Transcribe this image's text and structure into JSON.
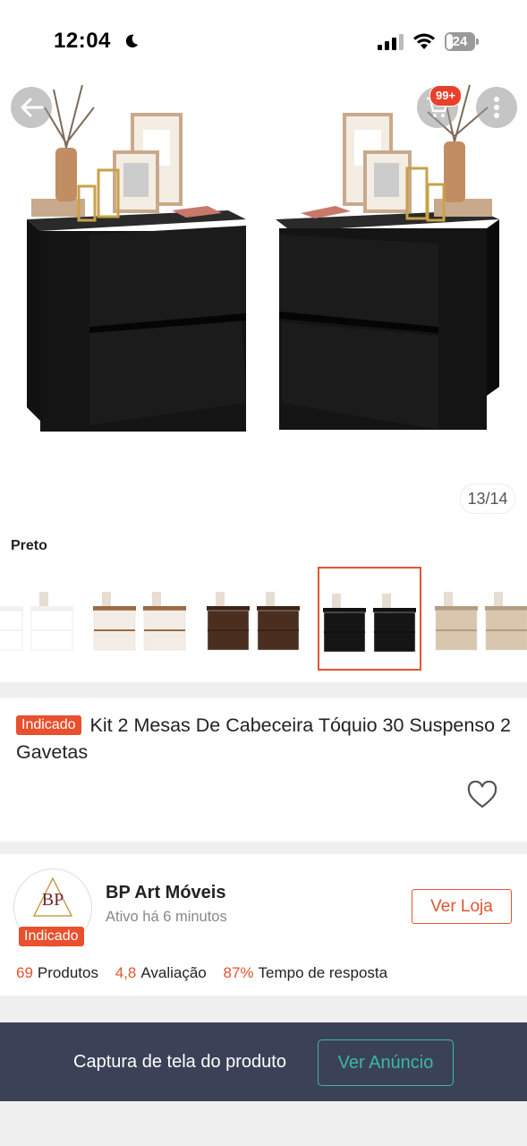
{
  "status_bar": {
    "time": "12:04",
    "battery": "24",
    "battery_level": 0.24,
    "icons": [
      "moon-icon",
      "signal-icon",
      "wifi-icon",
      "battery-icon"
    ]
  },
  "gallery": {
    "cart_badge": "99+",
    "image_counter": "13/14",
    "icons": [
      "back-arrow-icon",
      "cart-icon",
      "more-icon"
    ]
  },
  "variant": {
    "label": "Preto",
    "selected_index": 3,
    "options": [
      {
        "top": "#f2f2f2",
        "body": "#ffffff"
      },
      {
        "top": "#9a6a45",
        "body": "#f3ede6"
      },
      {
        "top": "#3b2418",
        "body": "#4a2e1f"
      },
      {
        "top": "#111111",
        "body": "#151515"
      },
      {
        "top": "#b69c7e",
        "body": "#d9c6ae"
      }
    ]
  },
  "product": {
    "badge": "Indicado",
    "title": "Kit 2 Mesas De Cabeceira Tóquio 30 Suspenso 2 Gavetas"
  },
  "seller": {
    "logo_text": "BP",
    "badge": "Indicado",
    "name": "BP Art Móveis",
    "status": "Ativo há 6 minutos",
    "store_button": "Ver Loja",
    "stats": [
      {
        "value": "69",
        "label": "Produtos"
      },
      {
        "value": "4,8",
        "label": "Avaliação"
      },
      {
        "value": "87%",
        "label": "Tempo de resposta"
      }
    ]
  },
  "capture_bar": {
    "text": "Captura de tela do produto",
    "button": "Ver Anúncio"
  },
  "colors": {
    "accent": "#e8502e",
    "teal": "#3bb8a6",
    "bar": "#3b4257"
  }
}
